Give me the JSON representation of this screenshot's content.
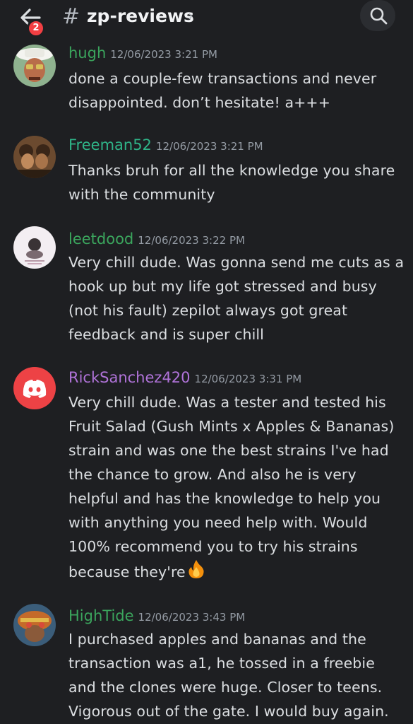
{
  "header": {
    "back_badge": "2",
    "hash": "#",
    "channel_name": "zp-reviews",
    "chevron": "›"
  },
  "messages": [
    {
      "username": "hugh",
      "name_color": "#3ba55d",
      "timestamp": "12/06/2023 3:21 PM",
      "lines": [
        "done a couple-few transactions and never",
        "disappointed. don’t hesitate! a+++"
      ]
    },
    {
      "username": "Freeman52",
      "name_color": "#2fb488",
      "timestamp": "12/06/2023 3:21 PM",
      "lines": [
        "Thanks bruh for all the knowledge you share",
        "with the community"
      ]
    },
    {
      "username": "leetdood",
      "name_color": "#3ba55d",
      "timestamp": "12/06/2023 3:22 PM",
      "lines": [
        "Very chill dude. Was gonna send me cuts as a",
        "hook up but my life got stressed and busy",
        "(not his fault) zepilot always got great",
        "feedback and is super chill"
      ]
    },
    {
      "username": "RickSanchez420",
      "name_color": "#b073d9",
      "timestamp": "12/06/2023 3:31 PM",
      "lines": [
        "Very chill dude. Was a tester and tested his",
        "Fruit Salad (Gush Mints x Apples & Bananas)",
        "strain and was one the best strains I've had",
        "the chance to grow. And also he is very",
        "helpful and has the knowledge to help you",
        "with anything you need help with.  Would",
        "100% recommend you to try his strains",
        "because they're"
      ],
      "emoji": "fire-emoji"
    },
    {
      "username": "HighTide",
      "name_color": "#3ba55d",
      "timestamp": "12/06/2023 3:43 PM",
      "lines": [
        "I purchased apples and bananas and the",
        "transaction was a1, he tossed in a freebie",
        "and the clones were huge. Closer to teens.",
        "Vigorous out of the gate. I would buy again."
      ]
    }
  ]
}
